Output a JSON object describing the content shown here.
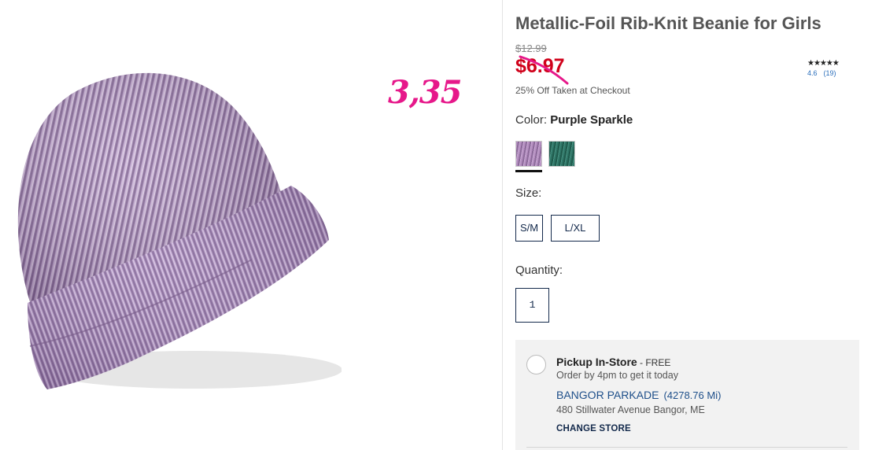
{
  "product": {
    "title": "Metallic-Foil Rib-Knit Beanie for Girls",
    "price_original": "$12.99",
    "price_sale": "$6.97",
    "discount_note": "25% Off Taken at Checkout",
    "rating": {
      "stars_glyph": "★★★★★",
      "value": "4.6",
      "count": "(19)"
    }
  },
  "annotation": {
    "text": "3,35"
  },
  "color": {
    "label": "Color:",
    "selected": "Purple Sparkle",
    "swatches": [
      "purple-sparkle",
      "teal-sparkle"
    ]
  },
  "size": {
    "label": "Size:",
    "options": [
      "S/M",
      "L/XL"
    ]
  },
  "quantity": {
    "label": "Quantity:",
    "value": "1"
  },
  "pickup": {
    "title": "Pickup In-Store",
    "free_label": " - FREE",
    "subtitle": "Order by 4pm to get it today",
    "store_name": "BANGOR PARKADE",
    "store_distance": "(4278.76 Mi)",
    "store_address": "480 Stillwater Avenue Bangor, ME",
    "change_store_label": "CHANGE STORE"
  },
  "colors": {
    "sale_red": "#d0021b",
    "navy": "#13294b",
    "link_blue": "#1e4f8a",
    "annotation_pink": "#e6188a",
    "beanie_purple": "#9b79a8"
  }
}
